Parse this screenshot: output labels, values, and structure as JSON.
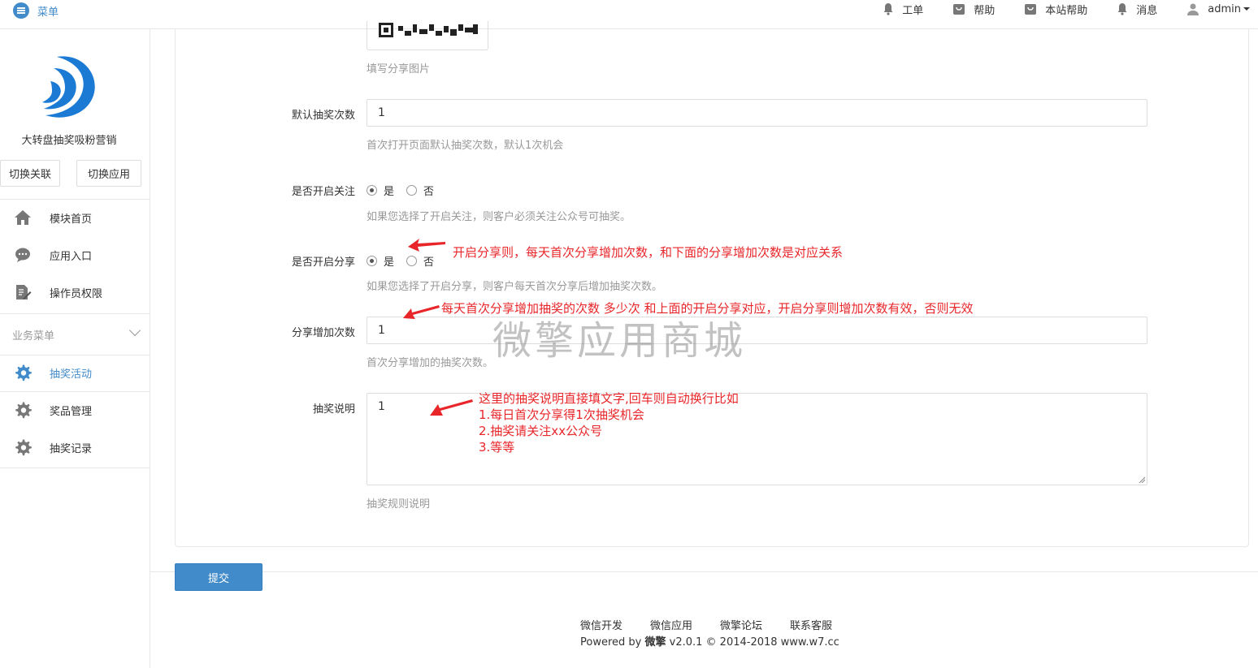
{
  "topbar": {
    "menu_label": "菜单",
    "nav": [
      {
        "label": "工单",
        "icon": "bell-icon"
      },
      {
        "label": "帮助",
        "icon": "bag-icon"
      },
      {
        "label": "本站帮助",
        "icon": "bag-icon"
      },
      {
        "label": "消息",
        "icon": "bell-icon"
      },
      {
        "label": "admin",
        "icon": "user-icon"
      }
    ]
  },
  "sidebar": {
    "app_name": "大转盘抽奖吸粉营销",
    "switch_link_label": "切换关联",
    "switch_app_label": "切换应用",
    "items": [
      {
        "label": "模块首页",
        "icon": "home-icon"
      },
      {
        "label": "应用入口",
        "icon": "chat-icon"
      },
      {
        "label": "操作员权限",
        "icon": "edit-document-icon"
      }
    ],
    "section_title": "业务菜单",
    "business_items": [
      {
        "label": "抽奖活动",
        "icon": "gear-icon",
        "active": true
      },
      {
        "label": "奖品管理",
        "icon": "gear-icon"
      },
      {
        "label": "抽奖记录",
        "icon": "gear-icon"
      }
    ]
  },
  "form": {
    "share_image_help": "填写分享图片",
    "default_draws": {
      "label": "默认抽奖次数",
      "value": "1",
      "help": "首次打开页面默认抽奖次数，默认1次机会"
    },
    "enable_follow": {
      "label": "是否开启关注",
      "yes": "是",
      "no": "否",
      "help": "如果您选择了开启关注，则客户必须关注公众号可抽奖。"
    },
    "enable_share": {
      "label": "是否开启分享",
      "yes": "是",
      "no": "否",
      "help": "如果您选择了开启分享，则客户每天首次分享后增加抽奖次数。"
    },
    "share_add": {
      "label": "分享增加次数",
      "value": "1",
      "help": "首次分享增加的抽奖次数。"
    },
    "description": {
      "label": "抽奖说明",
      "value": "1",
      "help": "抽奖规则说明"
    }
  },
  "annotations": {
    "share_note": "开启分享则，每天首次分享增加次数，和下面的分享增加次数是对应关系",
    "share_add_note": "每天首次分享增加抽奖的次数 多少次 和上面的开启分享对应，开启分享则增加次数有效，否则无效",
    "desc_lines": [
      "这里的抽奖说明直接填文字,回车则自动换行比如",
      "1.每日首次分享得1次抽奖机会",
      "2.抽奖请关注xx公众号",
      "3.等等"
    ]
  },
  "watermark": "微擎应用商城",
  "submit_label": "提交",
  "footer": {
    "links": [
      "微信开发",
      "微信应用",
      "微擎论坛",
      "联系客服"
    ],
    "powered_prefix": "Powered by ",
    "powered_brand": "微擎",
    "powered_suffix": " v2.0.1 © 2014-2018 www.w7.cc"
  },
  "colors": {
    "primary": "#428bca",
    "annotation": "#e8262a",
    "brand_logo": "#1b7ad4"
  }
}
